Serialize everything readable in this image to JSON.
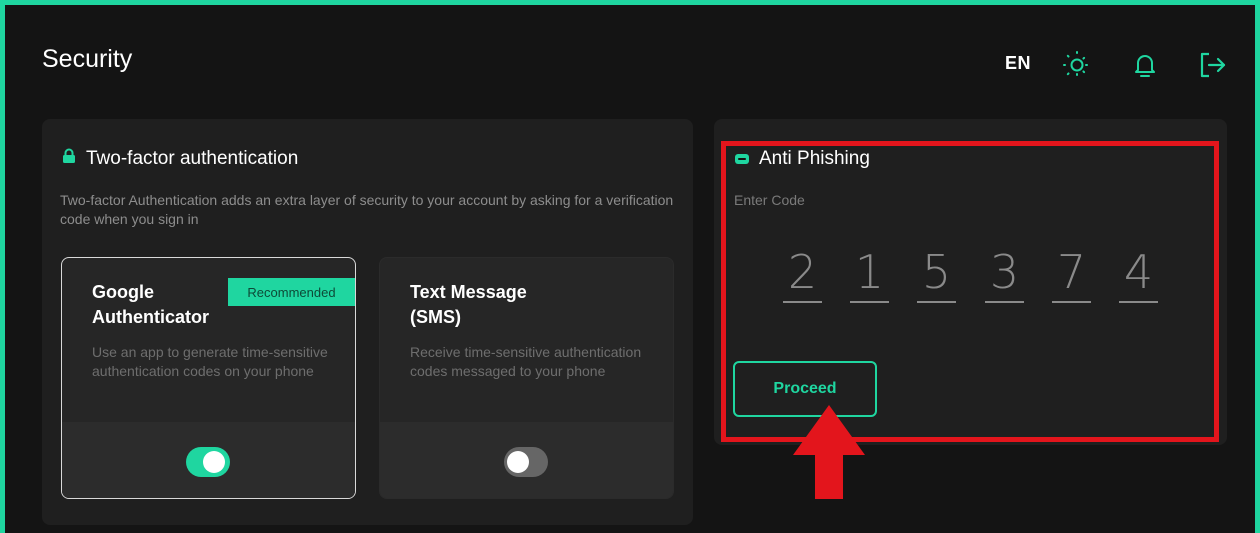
{
  "header": {
    "title": "Security",
    "language": "EN",
    "icons": [
      "sun-icon",
      "bell-icon",
      "logout-icon"
    ]
  },
  "two_factor": {
    "heading": "Two-factor authentication",
    "description": "Two-factor Authentication adds an extra layer of security to your account by asking for a verification code when you sign in",
    "google": {
      "title": "Google Authenticator",
      "badge": "Recommended",
      "description": "Use an app to generate time-sensitive authentication codes on your phone",
      "enabled": true
    },
    "sms": {
      "title": "Text Message (SMS)",
      "description": "Receive time-sensitive authentication codes messaged to your phone",
      "enabled": false
    }
  },
  "anti_phishing": {
    "heading": "Anti Phishing",
    "code_label": "Enter Code",
    "code_digits": [
      "2",
      "1",
      "5",
      "3",
      "7",
      "4"
    ],
    "proceed_label": "Proceed"
  },
  "colors": {
    "accent": "#1fd6a0",
    "background": "#141414",
    "panel": "#1f1f1f",
    "annotation_red": "#e3151c"
  }
}
